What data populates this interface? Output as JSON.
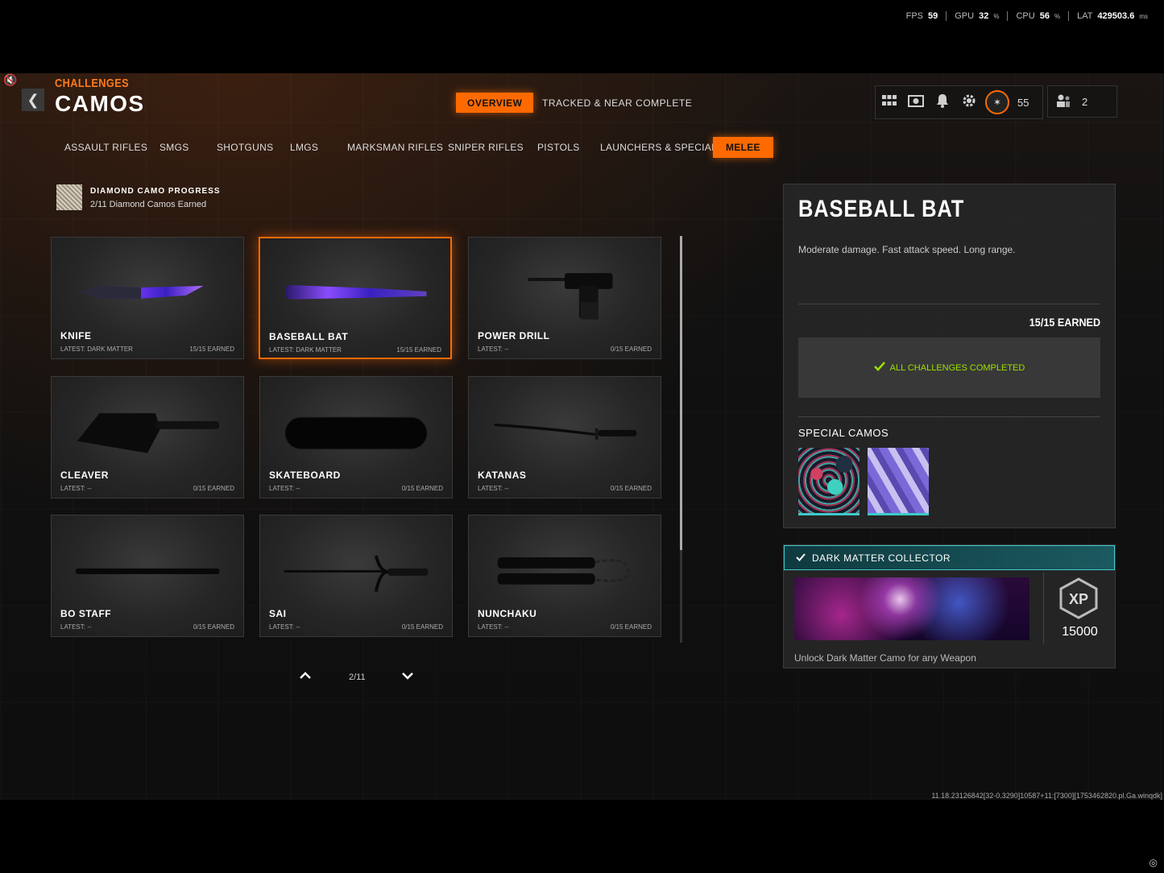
{
  "perf": {
    "fps_label": "FPS",
    "fps_value": "59",
    "gpu_label": "GPU",
    "gpu_value": "32",
    "gpu_unit": "%",
    "cpu_label": "CPU",
    "cpu_value": "56",
    "cpu_unit": "%",
    "lat_label": "LAT",
    "lat_value": "429503.6",
    "lat_unit": "ms"
  },
  "header": {
    "breadcrumb": "CHALLENGES",
    "title": "CAMOS",
    "tabs": [
      {
        "label": "OVERVIEW",
        "active": true
      },
      {
        "label": "TRACKED & NEAR COMPLETE",
        "active": false
      }
    ],
    "token_count": "55",
    "party_count": "2"
  },
  "categories": [
    {
      "label": "ASSAULT RIFLES",
      "active": false
    },
    {
      "label": "SMGS",
      "active": false
    },
    {
      "label": "SHOTGUNS",
      "active": false
    },
    {
      "label": "LMGS",
      "active": false
    },
    {
      "label": "MARKSMAN RIFLES",
      "active": false
    },
    {
      "label": "SNIPER RIFLES",
      "active": false
    },
    {
      "label": "PISTOLS",
      "active": false
    },
    {
      "label": "LAUNCHERS & SPECIALS",
      "active": false
    },
    {
      "label": "MELEE",
      "active": true
    }
  ],
  "progress": {
    "title": "DIAMOND CAMO PROGRESS",
    "subtitle": "2/11 Diamond Camos Earned"
  },
  "weapons": [
    {
      "name": "KNIFE",
      "latest": "LATEST: DARK MATTER",
      "earned": "15/15 EARNED",
      "icon": "knife"
    },
    {
      "name": "BASEBALL BAT",
      "latest": "LATEST: DARK MATTER",
      "earned": "15/15 EARNED",
      "icon": "baseball-bat",
      "selected": true
    },
    {
      "name": "POWER DRILL",
      "latest": "LATEST: --",
      "earned": "0/15 EARNED",
      "icon": "power-drill"
    },
    {
      "name": "CLEAVER",
      "latest": "LATEST: --",
      "earned": "0/15 EARNED",
      "icon": "cleaver"
    },
    {
      "name": "SKATEBOARD",
      "latest": "LATEST: --",
      "earned": "0/15 EARNED",
      "icon": "skateboard"
    },
    {
      "name": "KATANAS",
      "latest": "LATEST: --",
      "earned": "0/15 EARNED",
      "icon": "katana"
    },
    {
      "name": "BO STAFF",
      "latest": "LATEST: --",
      "earned": "0/15 EARNED",
      "icon": "bo-staff"
    },
    {
      "name": "SAI",
      "latest": "LATEST: --",
      "earned": "0/15 EARNED",
      "icon": "sai"
    },
    {
      "name": "NUNCHAKU",
      "latest": "LATEST: --",
      "earned": "0/15 EARNED",
      "icon": "nunchaku"
    }
  ],
  "pager": {
    "label": "2/11"
  },
  "detail": {
    "title": "BASEBALL BAT",
    "description": "Moderate damage.  Fast attack speed. Long range.",
    "earned": "15/15 EARNED",
    "status": "ALL CHALLENGES COMPLETED",
    "special_title": "SPECIAL CAMOS"
  },
  "reward": {
    "title": "DARK MATTER COLLECTOR",
    "xp_value": "15000",
    "description": "Unlock Dark Matter Camo for any Weapon"
  },
  "build_info": "11.18.23126842[32-0.3290]10587+11:[7300][1753462820.pl.Ga.winqdk]",
  "colors": {
    "accent": "#ff6a00",
    "complete": "#9be000",
    "teal": "#3fc9c9"
  }
}
